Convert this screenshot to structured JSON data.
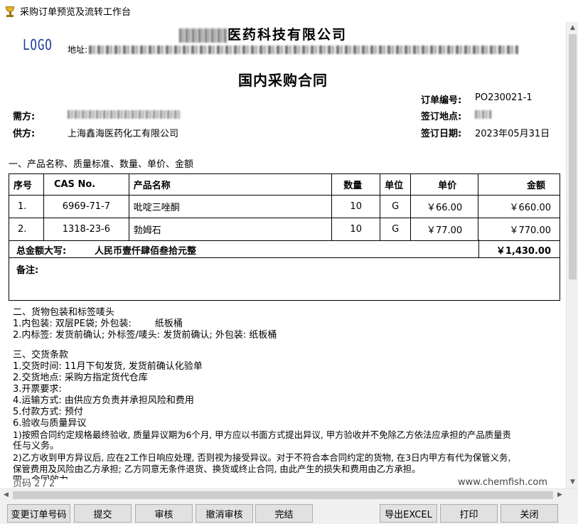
{
  "window": {
    "title": "采购订单预览及流转工作台"
  },
  "header": {
    "logo": "LOGO",
    "company_name_visible": "医药科技有限公司",
    "address_label": "地址:",
    "contract_title": "国内采购合同"
  },
  "meta": {
    "order_no_label": "订单编号:",
    "order_no": "PO230021-1",
    "sign_place_label": "签订地点:",
    "sign_date_label": "签订日期:",
    "sign_date": "2023年05月31日",
    "buyer_label": "需方:",
    "supplier_label": "供方:",
    "supplier": "上海鑫海医药化工有限公司"
  },
  "section1_title": "一、产品名称、质量标准、数量、单价、金额",
  "table": {
    "headers": [
      "序号",
      "CAS No.",
      "产品名称",
      "数量",
      "单位",
      "单价",
      "金额"
    ],
    "rows": [
      [
        "1.",
        "6969-71-7",
        "吡啶三唑酮",
        "10",
        "G",
        "￥66.00",
        "￥660.00"
      ],
      [
        "2.",
        "1318-23-6",
        "勃姆石",
        "10",
        "G",
        "￥77.00",
        "￥770.00"
      ]
    ],
    "total_label": "总金额大写:",
    "total_words": "人民币壹仟肆佰叁拾元整",
    "total_value": "￥1,430.00",
    "remark_label": "备注:"
  },
  "section2": {
    "title": "二、货物包装和标签唛头",
    "line1": "1.内包装: 双层PE袋; 外包装:        纸板桶",
    "line2": "2.内标签: 发货前确认; 外标签/唛头: 发货前确认; 外包装: 纸板桶"
  },
  "section3": {
    "title": "三、交货条款",
    "lines": [
      "1.交货时间: 11月下旬发货, 发货前确认化验单",
      "2.交货地点: 采购方指定货代仓库",
      "3.开票要求:",
      "4.运输方式: 由供应方负责并承担风险和费用",
      "5.付款方式: 预付",
      "6.验收与质量异议",
      " 1)按照合同约定规格最终验收, 质量异议期为6个月, 甲方应以书面方式提出异议, 甲方验收并不免除乙方依法应承担的产品质量责",
      "任与义务。",
      "2)乙方收到甲方异议后, 应在2工作日响应处理, 否则视为接受异议。对于不符合本合同约定的货物, 在3日内甲方有代为保管义务,",
      "保管费用及风险由乙方承担; 乙方同意无条件退货、换货或终止合同, 由此产生的损失和费用由乙方承担。",
      "四、合同效力"
    ]
  },
  "footer": {
    "page_label": "页码 2 / 2",
    "website": "www.chemfish.com"
  },
  "buttons": {
    "change_order_no": "变更订单号码",
    "submit": "提交",
    "review": "审核",
    "cancel_review": "撤消审核",
    "complete": "完结",
    "export_excel": "导出EXCEL",
    "print": "打印",
    "close": "关闭"
  }
}
